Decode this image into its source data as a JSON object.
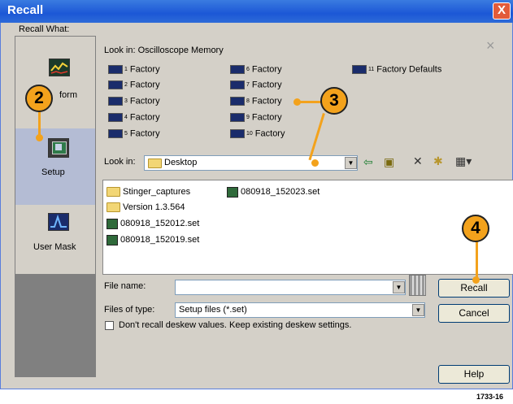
{
  "window": {
    "title": "Recall",
    "close_glyph": "X"
  },
  "sidebar": {
    "heading": "Recall What:",
    "items": [
      {
        "label": "Waveform",
        "visible_label": "form"
      },
      {
        "label": "Setup"
      },
      {
        "label": "User Mask"
      }
    ]
  },
  "memory": {
    "look_in_label": "Look in: Oscilloscope Memory",
    "dismiss_glyph": "×",
    "slots": [
      {
        "num": "1",
        "label": "Factory"
      },
      {
        "num": "2",
        "label": "Factory"
      },
      {
        "num": "3",
        "label": "Factory"
      },
      {
        "num": "4",
        "label": "Factory"
      },
      {
        "num": "5",
        "label": "Factory"
      },
      {
        "num": "6",
        "label": "Factory"
      },
      {
        "num": "7",
        "label": "Factory"
      },
      {
        "num": "8",
        "label": "Factory"
      },
      {
        "num": "9",
        "label": "Factory"
      },
      {
        "num": "10",
        "label": "Factory"
      },
      {
        "num": "11",
        "label": "Factory Defaults"
      }
    ]
  },
  "browser": {
    "look_in_label": "Look in:",
    "look_in_value": "Desktop",
    "files": [
      {
        "type": "folder",
        "name": "Stinger_captures"
      },
      {
        "type": "folder",
        "name": "Version 1.3.564"
      },
      {
        "type": "set",
        "name": "080918_152012.set"
      },
      {
        "type": "set",
        "name": "080918_152019.set"
      },
      {
        "type": "set",
        "name": "080918_152023.set"
      }
    ],
    "file_name_label": "File name:",
    "file_name_value": "",
    "file_type_label": "Files of type:",
    "file_type_value": "Setup files (*.set)",
    "deskew_checkbox_label": "Don't recall deskew values. Keep existing deskew settings.",
    "deskew_checked": false
  },
  "buttons": {
    "recall": "Recall",
    "cancel": "Cancel",
    "help": "Help"
  },
  "callouts": [
    "2",
    "3",
    "4"
  ],
  "figure_id": "1733-16",
  "colors": {
    "titlebar": "#1c57d6",
    "callout": "#f3a21c",
    "selected_nav": "#b4bcd4"
  }
}
